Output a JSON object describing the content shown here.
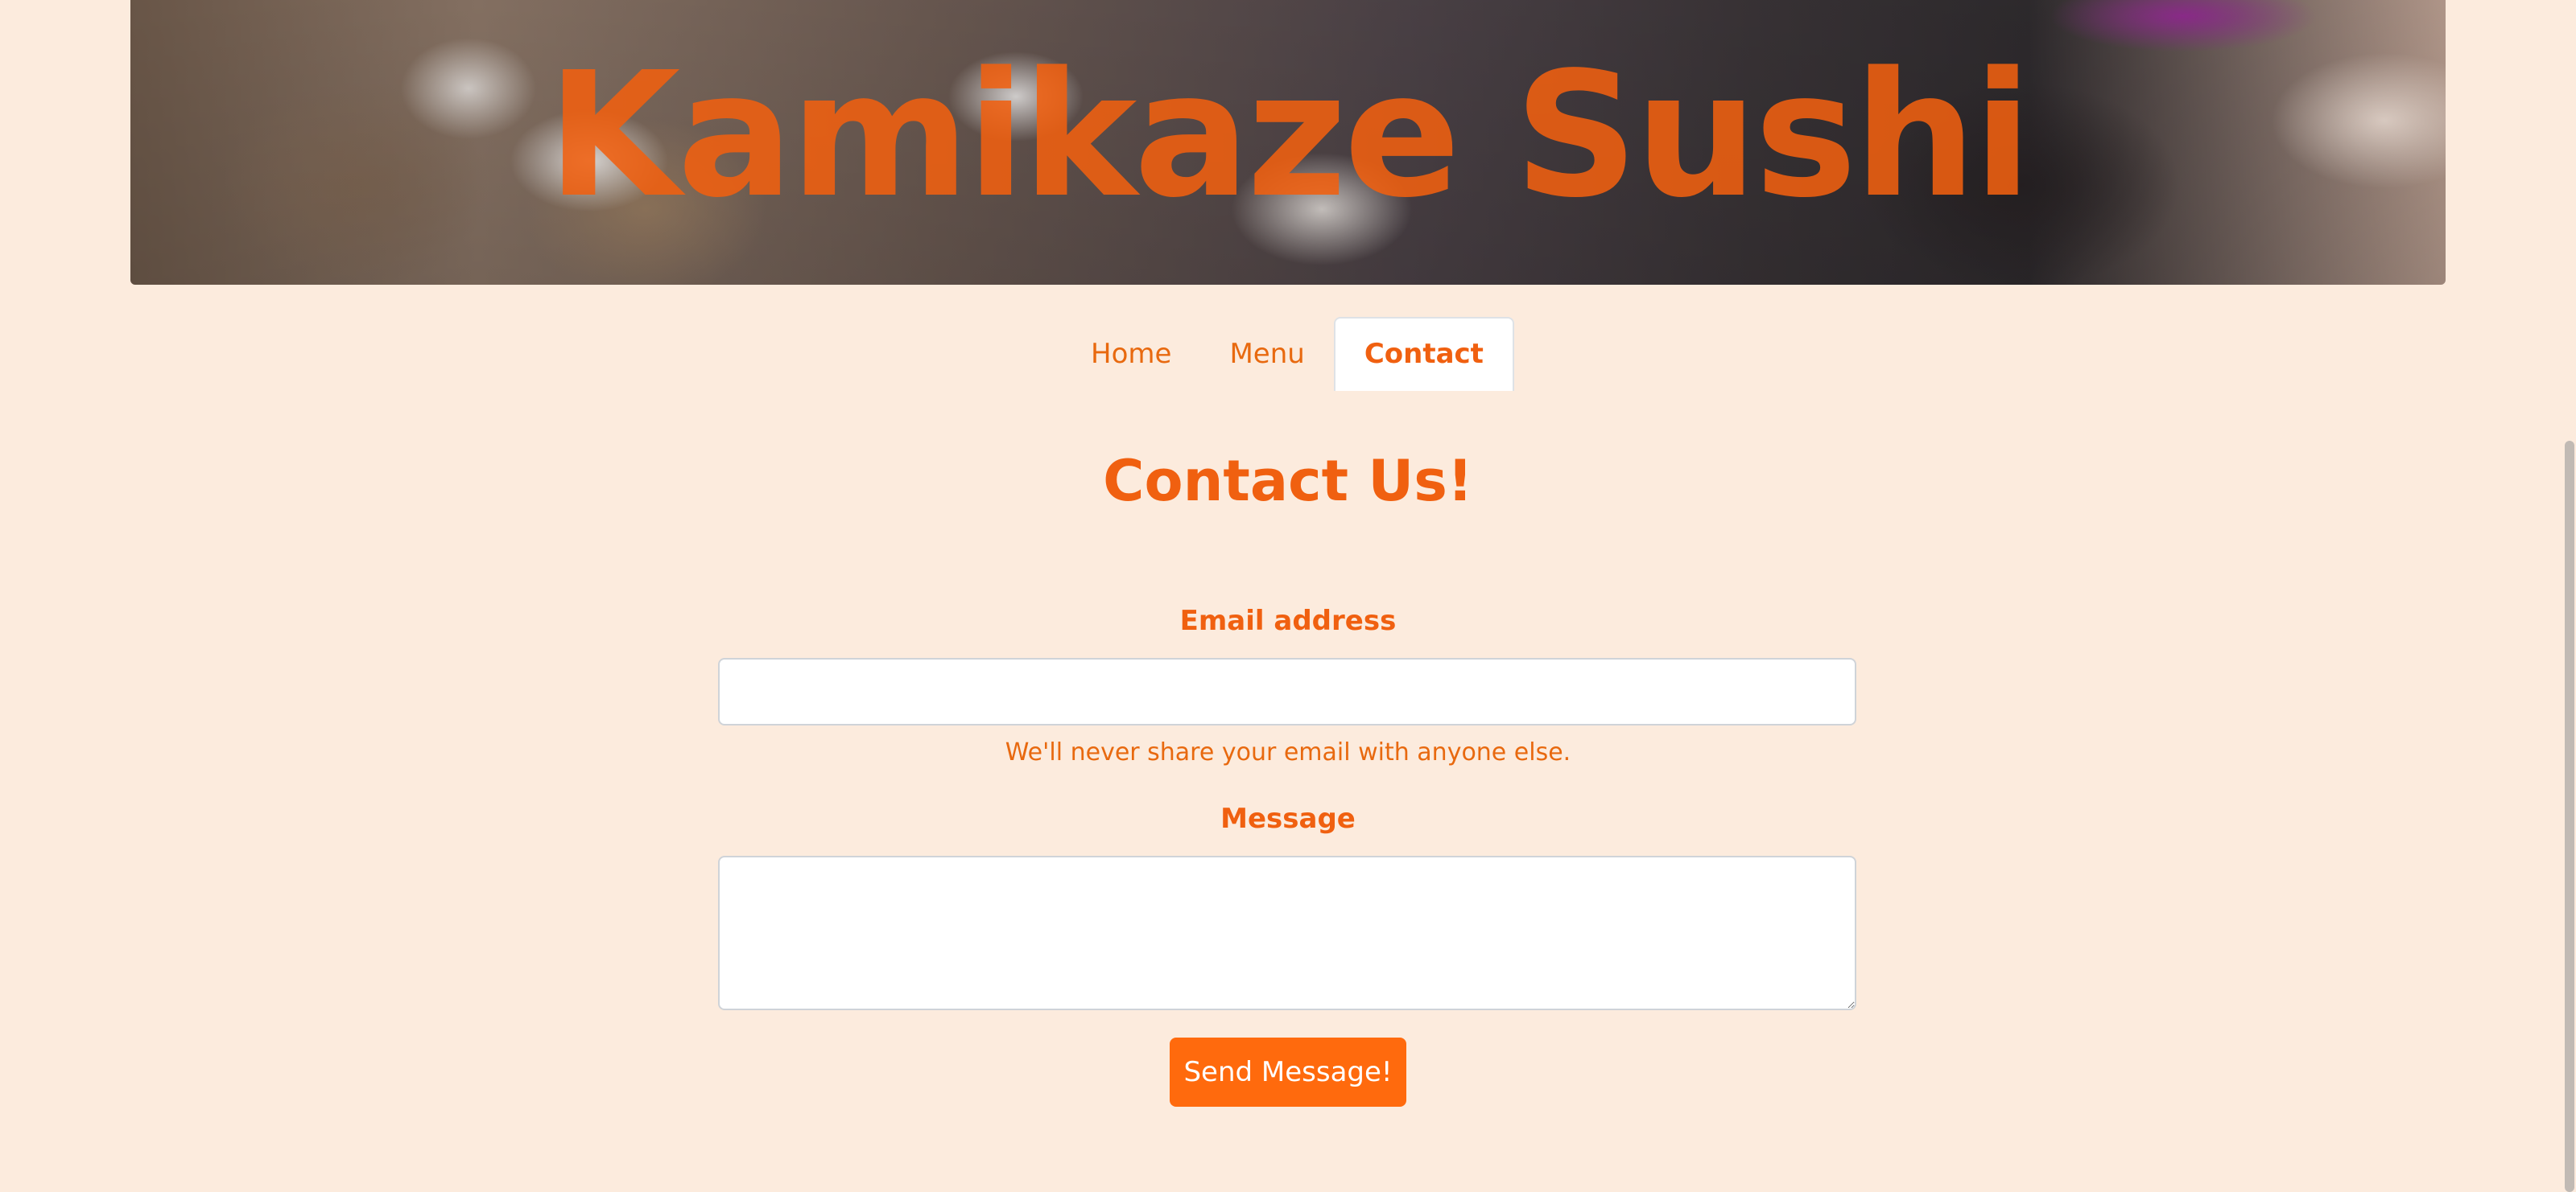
{
  "hero": {
    "title": "Kamikaze Sushi"
  },
  "nav": {
    "items": [
      {
        "label": "Home",
        "active": false
      },
      {
        "label": "Menu",
        "active": false
      },
      {
        "label": "Contact",
        "active": true
      }
    ]
  },
  "main": {
    "heading": "Contact Us!",
    "email_label": "Email address",
    "email_value": "",
    "email_help": "We'll never share your email with anyone else.",
    "message_label": "Message",
    "message_value": "",
    "submit_label": "Send Message!"
  },
  "colors": {
    "accent": "#f06010",
    "background": "#fcebdd",
    "button": "#ff6a0d"
  }
}
